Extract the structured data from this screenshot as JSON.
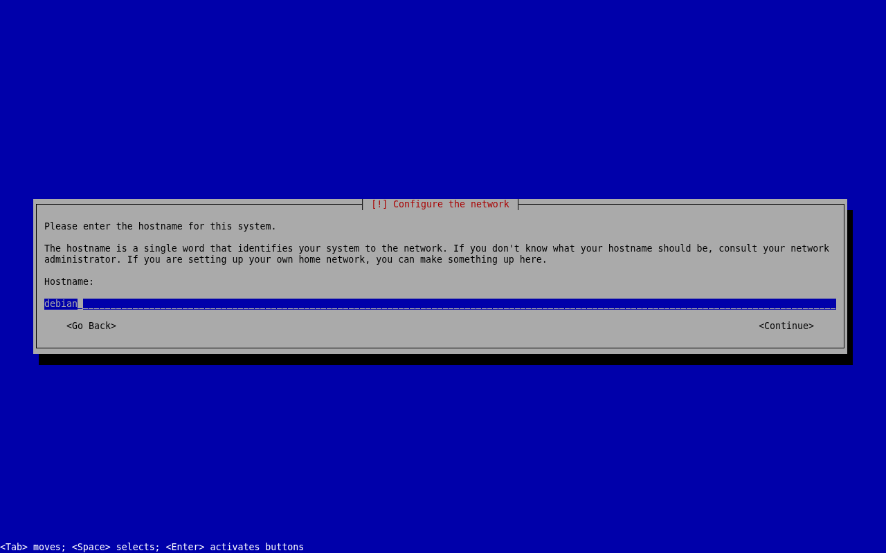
{
  "dialog": {
    "title": "[!] Configure the network",
    "paragraphs": [
      "Please enter the hostname for this system.",
      "The hostname is a single word that identifies your system to the network. If you don't know what your hostname should be, consult your network administrator. If you are setting up your own home network, you can make something up here."
    ],
    "field": {
      "label": "Hostname:",
      "value": "debian",
      "focused": true
    },
    "buttons": [
      "<Go Back>",
      "<Continue>"
    ]
  },
  "status_bar": {
    "hint": "<Tab> moves; <Space> selects; <Enter> activates buttons"
  }
}
